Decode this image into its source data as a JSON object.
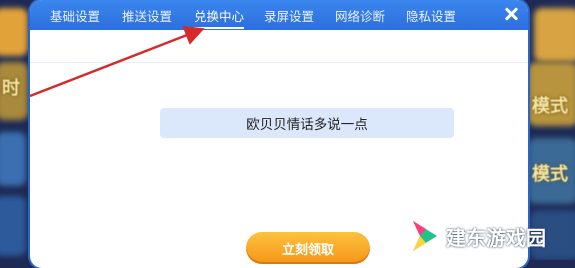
{
  "tabs": [
    {
      "label": "基础设置"
    },
    {
      "label": "推送设置"
    },
    {
      "label": "兑换中心"
    },
    {
      "label": "录屏设置"
    },
    {
      "label": "网络诊断"
    },
    {
      "label": "隐私设置"
    }
  ],
  "active_tab": "兑换中心",
  "redeem": {
    "code_value": "欧贝贝情话多说一点",
    "submit_label": "立刻领取"
  },
  "background": {
    "left_text": "时",
    "right_text_1": "模式",
    "right_text_2": "模式"
  },
  "watermark": {
    "text": "建东游戏园"
  },
  "colors": {
    "tab_bar": "#2f77e3",
    "accent_button": "#f7a02a",
    "field_bg": "#dbe8fb",
    "annotation": "#d62a2a"
  }
}
